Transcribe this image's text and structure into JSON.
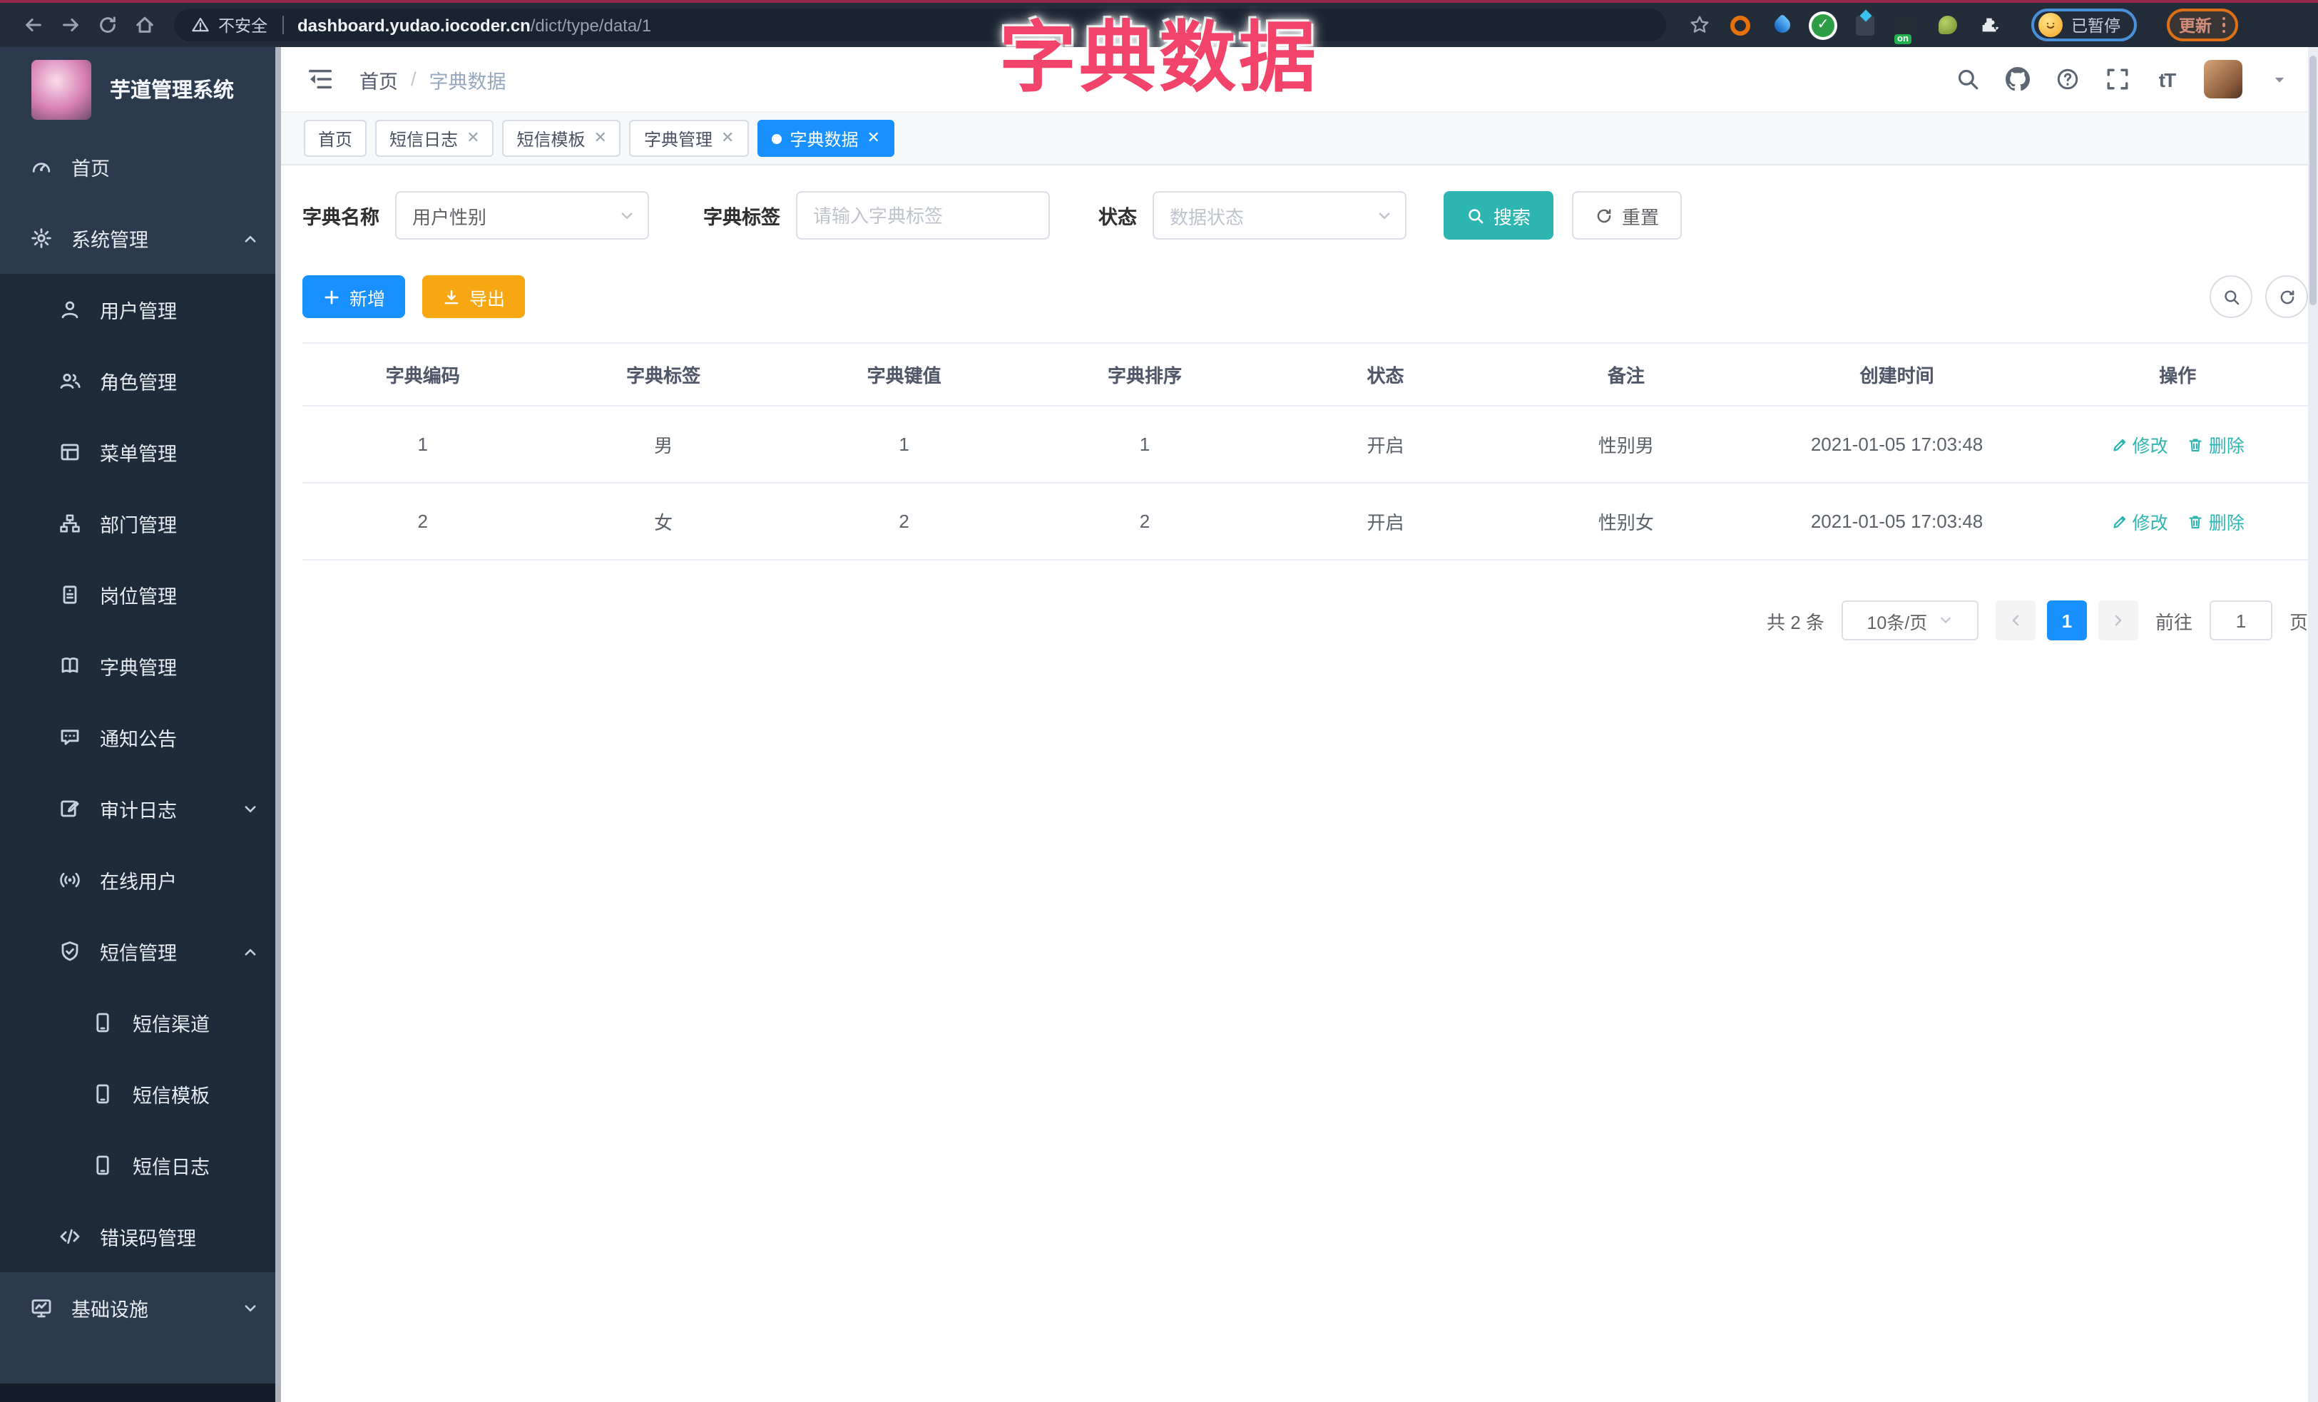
{
  "browser": {
    "security_label": "不安全",
    "url_host": "dashboard.yudao.iocoder.cn",
    "url_path": "/dict/type/data/1",
    "ext_on_badge": "on",
    "profile_status": "已暂停",
    "update_label": "更新"
  },
  "overlay": {
    "title": "字典数据"
  },
  "colors": {
    "accent_blue": "#1890ff",
    "teal": "#2db5b2",
    "amber": "#f7a712",
    "overlay_pink": "#f2436a",
    "sidebar": "#2c3a4e"
  },
  "sidebar": {
    "logo_title": "芋道管理系统",
    "items": [
      {
        "label": "首页",
        "icon": "dashboard-icon"
      },
      {
        "label": "系统管理",
        "icon": "gear-icon",
        "state": "expanded"
      },
      {
        "label": "用户管理",
        "icon": "user-icon"
      },
      {
        "label": "角色管理",
        "icon": "users-icon"
      },
      {
        "label": "菜单管理",
        "icon": "menu-table-icon"
      },
      {
        "label": "部门管理",
        "icon": "org-tree-icon"
      },
      {
        "label": "岗位管理",
        "icon": "badge-icon"
      },
      {
        "label": "字典管理",
        "icon": "book-icon"
      },
      {
        "label": "通知公告",
        "icon": "message-icon"
      },
      {
        "label": "审计日志",
        "icon": "log-icon",
        "state": "collapsed"
      },
      {
        "label": "在线用户",
        "icon": "online-icon"
      },
      {
        "label": "短信管理",
        "icon": "shield-check-icon",
        "state": "expanded"
      },
      {
        "label": "短信渠道",
        "icon": "phone-icon"
      },
      {
        "label": "短信模板",
        "icon": "phone-icon"
      },
      {
        "label": "短信日志",
        "icon": "phone-icon"
      },
      {
        "label": "错误码管理",
        "icon": "code-icon"
      },
      {
        "label": "基础设施",
        "icon": "monitor-icon",
        "state": "collapsed"
      }
    ]
  },
  "header": {
    "breadcrumb_home": "首页",
    "breadcrumb_sep": "/",
    "breadcrumb_current": "字典数据"
  },
  "tabs": [
    {
      "label": "首页",
      "closable": false,
      "active": false
    },
    {
      "label": "短信日志",
      "closable": true,
      "active": false
    },
    {
      "label": "短信模板",
      "closable": true,
      "active": false
    },
    {
      "label": "字典管理",
      "closable": true,
      "active": false
    },
    {
      "label": "字典数据",
      "closable": true,
      "active": true
    }
  ],
  "filters": {
    "name_label": "字典名称",
    "name_value": "用户性别",
    "tag_label": "字典标签",
    "tag_placeholder": "请输入字典标签",
    "status_label": "状态",
    "status_placeholder": "数据状态",
    "search_label": "搜索",
    "reset_label": "重置"
  },
  "toolbar": {
    "add_label": "新增",
    "export_label": "导出"
  },
  "table": {
    "columns": [
      "字典编码",
      "字典标签",
      "字典键值",
      "字典排序",
      "状态",
      "备注",
      "创建时间",
      "操作"
    ],
    "edit_label": "修改",
    "delete_label": "删除",
    "rows": [
      {
        "code": "1",
        "label": "男",
        "value": "1",
        "sort": "1",
        "status": "开启",
        "remark": "性别男",
        "created": "2021-01-05 17:03:48"
      },
      {
        "code": "2",
        "label": "女",
        "value": "2",
        "sort": "2",
        "status": "开启",
        "remark": "性别女",
        "created": "2021-01-05 17:03:48"
      }
    ]
  },
  "pagination": {
    "total_label": "共 2 条",
    "page_size_label": "10条/页",
    "current_page": "1",
    "goto_label": "前往",
    "goto_value": "1",
    "unit_label": "页"
  }
}
